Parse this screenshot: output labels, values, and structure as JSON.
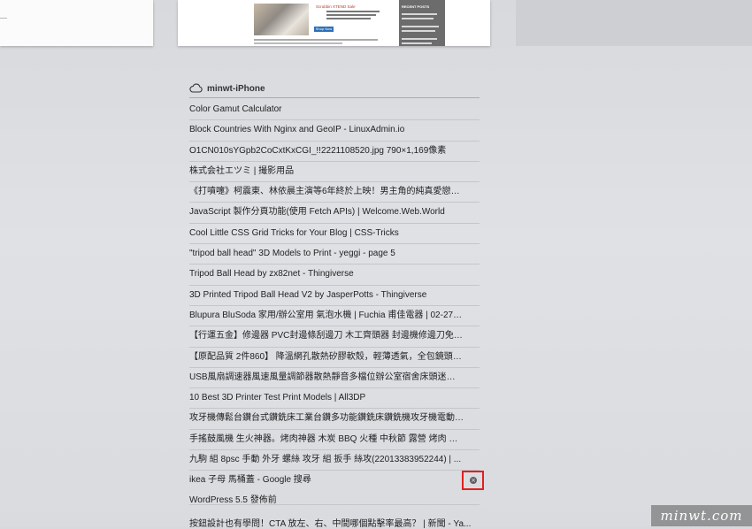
{
  "thumbnails": {
    "ad_title": "Scrubbin XTEND Sale",
    "ad_button": "Shop Now",
    "recent_posts_title": "RECENT POSTS"
  },
  "device": {
    "icon": "cloud-icon",
    "name": "minwt-iPhone"
  },
  "tabs": [
    "Color Gamut Calculator",
    "Block Countries With Nginx and GeoIP - LinuxAdmin.io",
    "O1CN010sYGpb2CoCxtKxCGI_!!2221108520.jpg 790×1,169像素",
    "株式会社エツミ | 撮影用品",
    "《打噴嚏》柯震東、林依晨主演等6年終於上映！男主角的純真愛戀：...",
    "JavaScript 製作分頁功能(使用 Fetch APIs) | Welcome.Web.World",
    "Cool Little CSS Grid Tricks for Your Blog | CSS-Tricks",
    "\"tripod ball head\" 3D Models to Print - yeggi - page 5",
    "Tripod Ball Head by zx82net - Thingiverse",
    "3D Printed Tripod Ball Head V2 by JasperPotts - Thingiverse",
    "Blupura BluSoda 家用/辦公室用 氣泡水機 | Fuchia 甫佳電器 | 02-2736...",
    "【行運五金】修邊器 PVC封邊條刮邊刀 木工齊頭器 封邊機修邊刀免漆...",
    "【原配品質 2件860】 降溫網孔散熱矽膠軟殼，輕薄透氣，全包鏡頭更...",
    "USB風扇調速器風速風量調節器散熱靜音多檔位辦公室宿舍床頭迷你(22...",
    "10 Best 3D Printer Test Print Models | All3DP",
    "攻牙機傳鬆台鑽台式鑽銑床工業台鑽多功能鑽銑床鑽銑機攻牙機電動攻...",
    "手搖鼓風機 生火神器。烤肉神器 木炭 BBQ 火種 中秋節 露營 烤肉 烤肉...",
    "九駒 組 8psc 手動 外牙 螺絲 攻牙 組 扳手 絲攻(22013383952244) | ...",
    "ikea 子母 馬桶蓋 - Google 搜尋"
  ],
  "close_button": {
    "icon": "close-circle-icon",
    "glyph": "×"
  },
  "extra_item": "WordPress 5.5 發佈前",
  "last_item": "按鈕設計也有學問！CTA 放左、右、中間哪個點擊率最高？ | 新聞 - Ya...",
  "watermark": "minwt.com"
}
